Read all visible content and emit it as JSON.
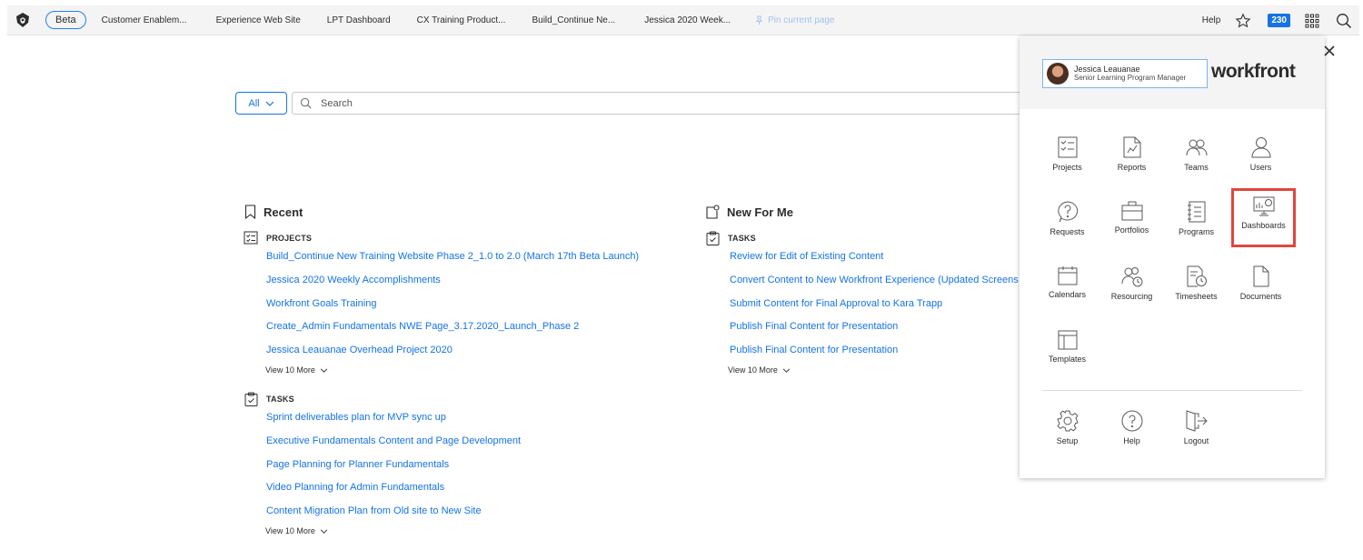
{
  "topbar": {
    "beta": "Beta",
    "tabs": [
      {
        "label": "Customer Enablem..."
      },
      {
        "label": "Experience Web Site"
      },
      {
        "label": "LPT Dashboard"
      },
      {
        "label": "CX Training Product..."
      },
      {
        "label": "Build_Continue Ne..."
      },
      {
        "label": "Jessica 2020 Week..."
      }
    ],
    "pin": "Pin current page",
    "help": "Help",
    "notification_count": "230",
    "accent_color": "#1473e6"
  },
  "search": {
    "scope": "All",
    "placeholder": "Search"
  },
  "recent": {
    "title": "Recent",
    "projects_label": "PROJECTS",
    "projects": [
      "Build_Continue New Training Website Phase 2_1.0 to 2.0 (March 17th Beta Launch)",
      "Jessica 2020 Weekly Accomplishments",
      "Workfront Goals Training",
      "Create_Admin Fundamentals NWE Page_3.17.2020_Launch_Phase 2",
      "Jessica Leauanae Overhead Project 2020"
    ],
    "projects_more": "View 10 More",
    "tasks_label": "TASKS",
    "tasks": [
      "Sprint deliverables plan for MVP sync up",
      "Executive Fundamentals Content and Page Development",
      "Page Planning for Planner Fundamentals",
      "Video Planning for Admin Fundamentals",
      "Content Migration Plan from Old site to New Site"
    ],
    "tasks_more": "View 10 More"
  },
  "new_for_me": {
    "title": "New For Me",
    "tasks_label": "TASKS",
    "tasks": [
      "Review for Edit of Existing Content",
      "Convert Content to New Workfront Experience (Updated Screens",
      "Submit Content for Final Approval to Kara Trapp",
      "Publish Final Content for Presentation",
      "Publish Final Content for Presentation"
    ],
    "tasks_more": "View 10 More"
  },
  "panel": {
    "user_name": "Jessica  Leauanae",
    "user_role": "Senior Learning Program Manager",
    "brand": "workfront",
    "apps": [
      {
        "label": "Projects",
        "icon": "projects-icon"
      },
      {
        "label": "Reports",
        "icon": "reports-icon"
      },
      {
        "label": "Teams",
        "icon": "teams-icon"
      },
      {
        "label": "Users",
        "icon": "users-icon"
      },
      {
        "label": "Requests",
        "icon": "requests-icon"
      },
      {
        "label": "Portfolios",
        "icon": "portfolios-icon"
      },
      {
        "label": "Programs",
        "icon": "programs-icon"
      },
      {
        "label": "Dashboards",
        "icon": "dashboards-icon",
        "highlighted": true
      },
      {
        "label": "Calendars",
        "icon": "calendars-icon"
      },
      {
        "label": "Resourcing",
        "icon": "resourcing-icon"
      },
      {
        "label": "Timesheets",
        "icon": "timesheets-icon"
      },
      {
        "label": "Documents",
        "icon": "documents-icon"
      },
      {
        "label": "Templates",
        "icon": "templates-icon"
      }
    ],
    "footer": [
      {
        "label": "Setup",
        "icon": "gear-icon"
      },
      {
        "label": "Help",
        "icon": "help-icon"
      },
      {
        "label": "Logout",
        "icon": "logout-icon"
      }
    ],
    "highlight_color": "#e0463e"
  }
}
